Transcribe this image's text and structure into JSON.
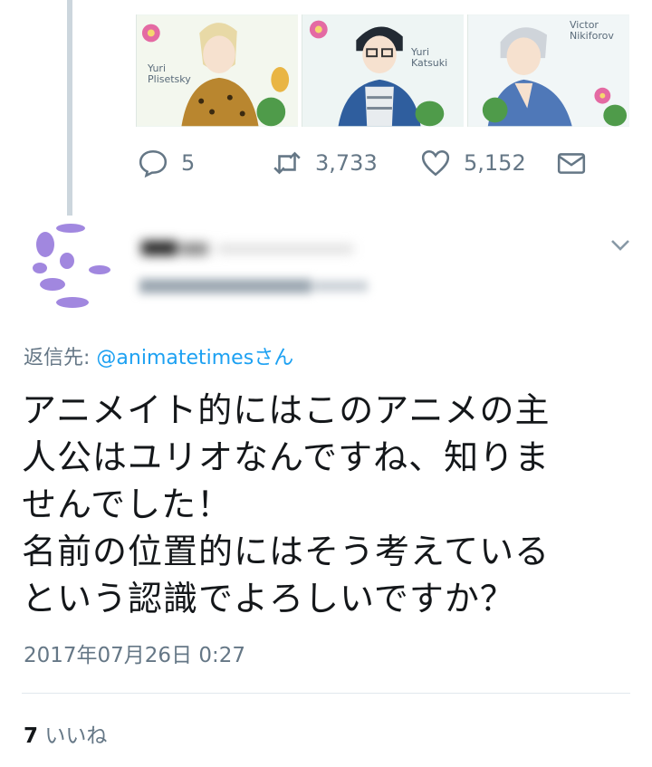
{
  "parent_tweet": {
    "media": {
      "cards": [
        {
          "name_line1": "Yuri",
          "name_line2": "Plisetsky"
        },
        {
          "name_line1": "Yuri",
          "name_line2": "Katsuki"
        },
        {
          "name_line1": "Victor",
          "name_line2": "Nikiforov"
        }
      ]
    },
    "actions": {
      "reply_icon": "reply-icon",
      "reply_count": "5",
      "retweet_icon": "retweet-icon",
      "retweet_count": "3,733",
      "like_icon": "heart-icon",
      "like_count": "5,152",
      "message_icon": "envelope-icon"
    }
  },
  "reply_tweet": {
    "caret_icon": "chevron-down-icon",
    "reply_to_label": "返信先: ",
    "reply_to_handle": "@animatetimes",
    "reply_to_suffix": "さん",
    "text_lines": [
      "アニメイト的にはこのアニメの主",
      "人公はユリオなんですね、知りま",
      "せんでした！",
      "名前の位置的にはそう考えている",
      "という認識でよろしいですか？"
    ],
    "timestamp": "2017年07月26日 0:27",
    "likes_count": "7",
    "likes_label": " いいね"
  },
  "colors": {
    "text": "#14171a",
    "secondary": "#657786",
    "link": "#1da1f2",
    "thread_line": "#ccd6dd",
    "divider": "#e1e8ed"
  }
}
